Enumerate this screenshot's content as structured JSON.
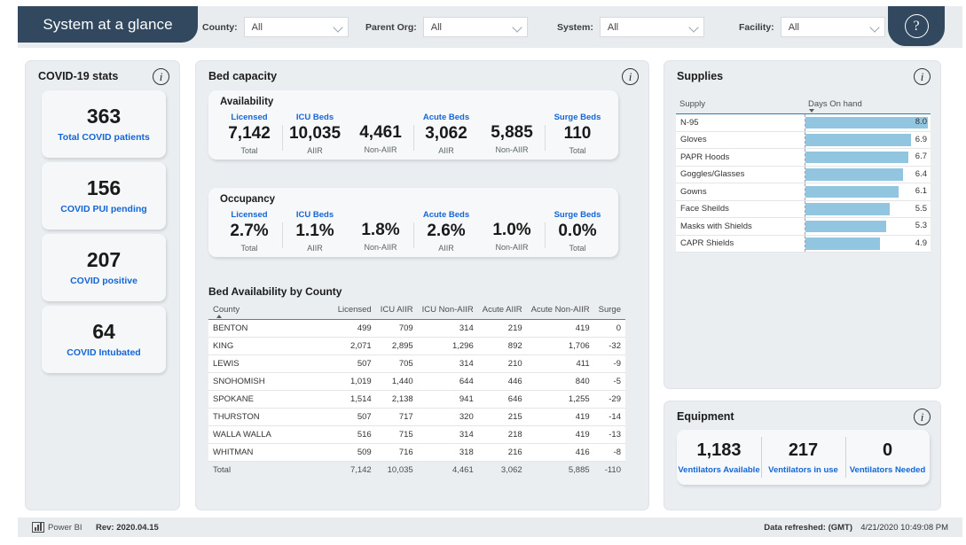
{
  "header": {
    "title": "System at a glance",
    "help_icon": "question-mark-icon",
    "filters": [
      {
        "label": "County:",
        "value": "All"
      },
      {
        "label": "Parent Org:",
        "value": "All"
      },
      {
        "label": "System:",
        "value": "All"
      },
      {
        "label": "Facility:",
        "value": "All"
      }
    ]
  },
  "covid_stats": {
    "title": "COVID-19 stats",
    "cards": [
      {
        "value": "363",
        "label": "Total COVID patients"
      },
      {
        "value": "156",
        "label": "COVID PUI pending"
      },
      {
        "value": "207",
        "label": "COVID positive"
      },
      {
        "value": "64",
        "label": "COVID Intubated"
      }
    ]
  },
  "bed_capacity": {
    "title": "Bed capacity",
    "availability": {
      "title": "Availability",
      "kpis": [
        {
          "group": "Licensed",
          "value": "7,142",
          "sub": "Total"
        },
        {
          "group": "ICU Beds",
          "value": "10,035",
          "sub": "AIIR"
        },
        {
          "group": "",
          "value": "4,461",
          "sub": "Non-AIIR"
        },
        {
          "group": "Acute Beds",
          "value": "3,062",
          "sub": "AIIR"
        },
        {
          "group": "",
          "value": "5,885",
          "sub": "Non-AIIR"
        },
        {
          "group": "Surge Beds",
          "value": "110",
          "sub": "Total"
        }
      ]
    },
    "occupancy": {
      "title": "Occupancy",
      "kpis": [
        {
          "group": "Licensed",
          "value": "2.7%",
          "sub": "Total"
        },
        {
          "group": "ICU Beds",
          "value": "1.1%",
          "sub": "AIIR"
        },
        {
          "group": "",
          "value": "1.8%",
          "sub": "Non-AIIR"
        },
        {
          "group": "Acute Beds",
          "value": "2.6%",
          "sub": "AIIR"
        },
        {
          "group": "",
          "value": "1.0%",
          "sub": "Non-AIIR"
        },
        {
          "group": "Surge Beds",
          "value": "0.0%",
          "sub": "Total"
        }
      ]
    },
    "table": {
      "title": "Bed Availability by County",
      "sort_column": "County",
      "sort_direction": "ascending",
      "columns": [
        "County",
        "Licensed",
        "ICU AIIR",
        "ICU Non-AIIR",
        "Acute AIIR",
        "Acute Non-AIIR",
        "Surge"
      ],
      "rows": [
        [
          "BENTON",
          "499",
          "709",
          "314",
          "219",
          "419",
          "0"
        ],
        [
          "KING",
          "2,071",
          "2,895",
          "1,296",
          "892",
          "1,706",
          "-32"
        ],
        [
          "LEWIS",
          "507",
          "705",
          "314",
          "210",
          "411",
          "-9"
        ],
        [
          "SNOHOMISH",
          "1,019",
          "1,440",
          "644",
          "446",
          "840",
          "-5"
        ],
        [
          "SPOKANE",
          "1,514",
          "2,138",
          "941",
          "646",
          "1,255",
          "-29"
        ],
        [
          "THURSTON",
          "507",
          "717",
          "320",
          "215",
          "419",
          "-14"
        ],
        [
          "WALLA WALLA",
          "516",
          "715",
          "314",
          "218",
          "419",
          "-13"
        ],
        [
          "WHITMAN",
          "509",
          "716",
          "318",
          "216",
          "416",
          "-8"
        ]
      ],
      "total_row": [
        "Total",
        "7,142",
        "10,035",
        "4,461",
        "3,062",
        "5,885",
        "-110"
      ]
    }
  },
  "supplies": {
    "title": "Supplies",
    "columns": [
      "Supply",
      "Days On hand"
    ],
    "sort_column": "Days On hand",
    "sort_direction": "descending",
    "bar_color": "#92c5e0",
    "max_value": 8.0,
    "rows": [
      {
        "name": "N-95",
        "value": "8.0",
        "num": 8.0
      },
      {
        "name": "Gloves",
        "value": "6.9",
        "num": 6.9
      },
      {
        "name": "PAPR Hoods",
        "value": "6.7",
        "num": 6.7
      },
      {
        "name": "Goggles/Glasses",
        "value": "6.4",
        "num": 6.4
      },
      {
        "name": "Gowns",
        "value": "6.1",
        "num": 6.1
      },
      {
        "name": "Face Sheilds",
        "value": "5.5",
        "num": 5.5
      },
      {
        "name": "Masks with Shields",
        "value": "5.3",
        "num": 5.3
      },
      {
        "name": "CAPR Shields",
        "value": "4.9",
        "num": 4.9
      }
    ]
  },
  "equipment": {
    "title": "Equipment",
    "items": [
      {
        "value": "1,183",
        "label": "Ventilators Available"
      },
      {
        "value": "217",
        "label": "Ventilators in use"
      },
      {
        "value": "0",
        "label": "Ventilators Needed"
      }
    ]
  },
  "footer": {
    "brand": "Power BI",
    "revision": "Rev: 2020.04.15",
    "refresh_label": "Data refreshed: (GMT)",
    "refresh_value": "4/21/2020 10:49:08 PM"
  }
}
